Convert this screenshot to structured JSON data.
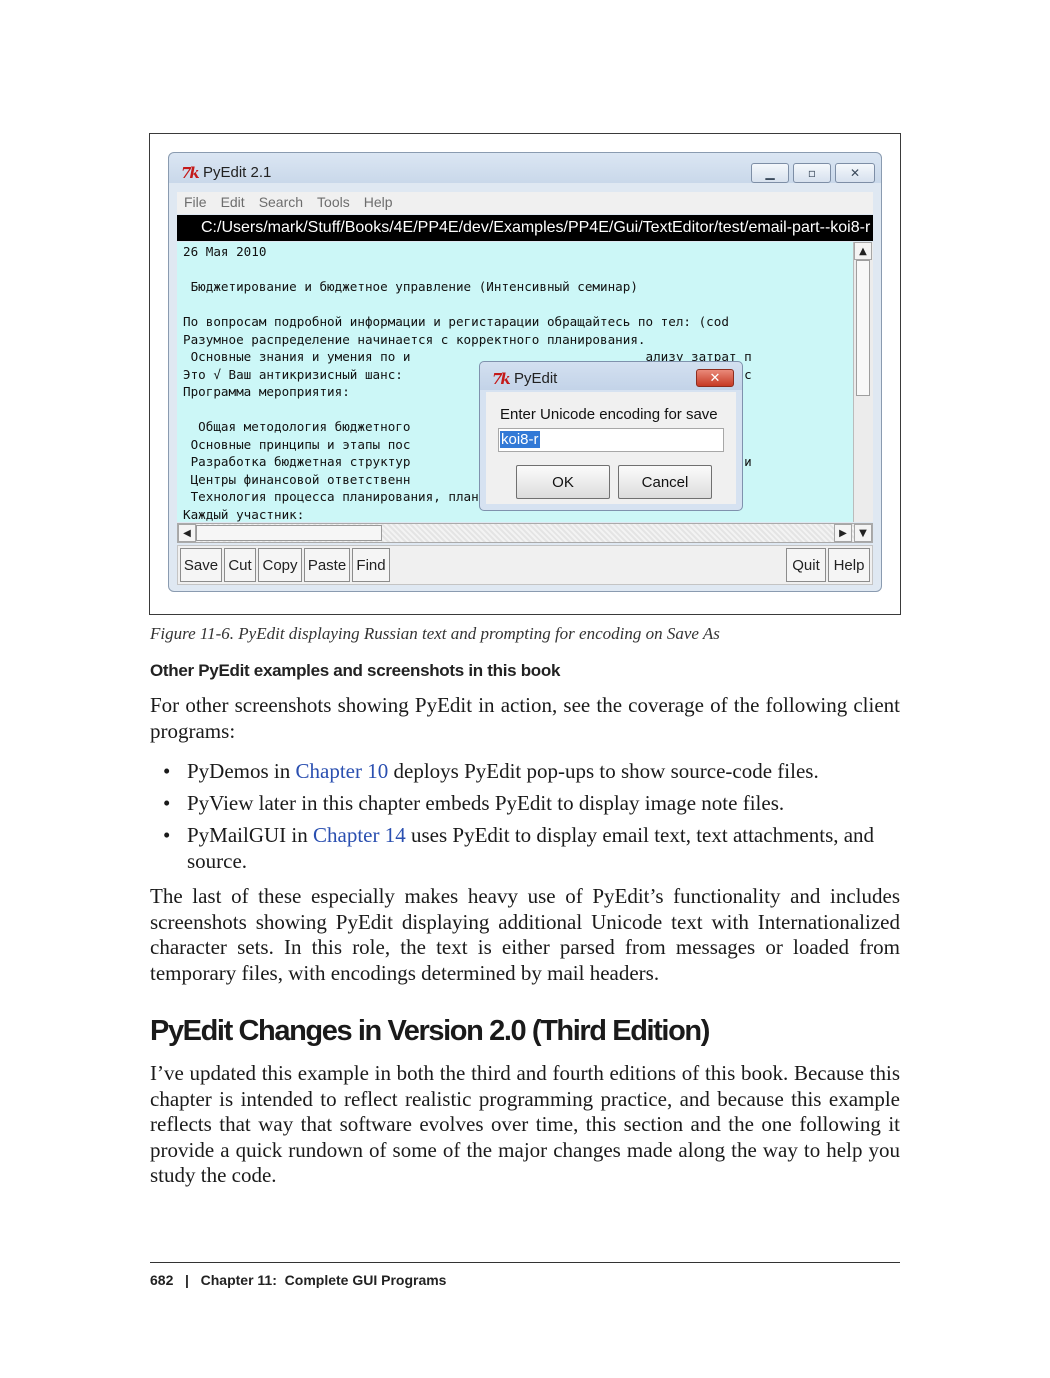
{
  "figure": {
    "window": {
      "logo": "7k",
      "title": "PyEdit 2.1",
      "controls": {
        "minimize": "▁",
        "maximize": "▫",
        "close": "✕"
      },
      "menu": [
        "File",
        "Edit",
        "Search",
        "Tools",
        "Help"
      ],
      "path": "C:/Users/mark/Stuff/Books/4E/PP4E/dev/Examples/PP4E/Gui/TextEditor/test/email-part--koi8-r",
      "editor_lines": [
        "26 Мая 2010",
        "",
        " Бюджетирование и бюджетное управление (Интенсивный семинар)",
        "",
        "По вопросам подробной информации и регистарации обращайтесь по тел: (cod",
        "Разумное распределение начинается с корректного планирования.",
        " Основные знания и умения по и                               ализу затрат п",
        "Это √ Ваш антикризисный шанс:                                день узнать вс",
        "Программа мероприятия:",
        "",
        "  Общая методология бюджетного                               начать?",
        " Основные принципы и этапы пос                               правления",
        " Разработка бюджетная структур                               й и составлени",
        " Центры финансовой ответственн                               компании",
        " Технология процесса планирования, план-фактного анализа и управления пс",
        "Каждый участник:"
      ],
      "scroll_arrows": {
        "up": "▲",
        "down": "▼",
        "left": "◀",
        "right": "▶"
      },
      "toolbar_left": [
        "Save",
        "Cut",
        "Copy",
        "Paste",
        "Find"
      ],
      "toolbar_right": [
        "Quit",
        "Help"
      ]
    },
    "dialog": {
      "logo": "7k",
      "title": "PyEdit",
      "close": "✕",
      "prompt": "Enter Unicode encoding for save",
      "input_value": "koi8-r",
      "ok_label": "OK",
      "cancel_label": "Cancel"
    }
  },
  "caption": "Figure 11-6. PyEdit displaying Russian text and prompting for encoding on Save As",
  "subheading": "Other PyEdit examples and screenshots in this book",
  "intro_para": "For other screenshots showing PyEdit in action, see the coverage of the following client programs:",
  "bullets": [
    {
      "pre": "PyDemos in ",
      "link": "Chapter 10",
      "post": " deploys PyEdit pop-ups to show source-code files."
    },
    {
      "pre": "PyView later in this chapter embeds PyEdit to display image note files.",
      "link": "",
      "post": ""
    },
    {
      "pre": "PyMailGUI in ",
      "link": "Chapter 14",
      "post": " uses PyEdit to display email text, text attachments, and source."
    }
  ],
  "para_last": "The last of these especially makes heavy use of PyEdit’s functionality and includes screenshots showing PyEdit displaying additional Unicode text with Internationalized character sets. In this role, the text is either parsed from messages or loaded from temporary files, with encodings determined by mail headers.",
  "section_title": "PyEdit Changes in Version 2.0 (Third Edition)",
  "section_para": "I’ve updated this example in both the third and fourth editions of this book. Because this chapter is intended to reflect realistic programming practice, and because this example reflects that way that software evolves over time, this section and the one following it provide a quick rundown of some of the major changes made along the way to help you study the code.",
  "footer": {
    "page": "682",
    "sep": "|",
    "chapter": "Chapter 11:  Complete GUI Programs"
  }
}
